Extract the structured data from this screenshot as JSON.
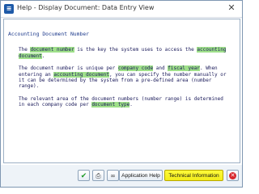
{
  "window": {
    "title": "Help - Display Document: Data Entry View",
    "icon": "sap-app-icon",
    "close_icon": "close-icon"
  },
  "document": {
    "heading": "Accounting Document Number",
    "p1": {
      "t1": "The ",
      "h1": "document number",
      "t2": " is the key the system uses to access the ",
      "h2": "accounting document",
      "t3": "."
    },
    "p2": {
      "t1": "The document number is unique per ",
      "h1": "company code",
      "t2": " and ",
      "h2": "fiscal year",
      "t3": ". When entering an ",
      "h3": "accounting document",
      "t4": ", you can specify the number manually or it can be determined by the system from a pre-defined area (number range)."
    },
    "p3": {
      "t1": "The relevant area of the document numbers (number range) is determined in each company code per ",
      "h1": "document type",
      "t2": "."
    }
  },
  "footer": {
    "ok_icon": "checkmark-icon",
    "print_icon": "printer-icon",
    "search_icon": "binoculars-icon",
    "app_help_label": "Application Help",
    "tech_info_label": "Technical Information",
    "cancel_icon": "cancel-icon"
  },
  "colors": {
    "highlight": "#9fe08a",
    "tech_button_highlight": "#fffb3a",
    "heading_blue": "#1d3a8c",
    "cancel_red": "#d8262c",
    "ok_green": "#1f9a28"
  }
}
